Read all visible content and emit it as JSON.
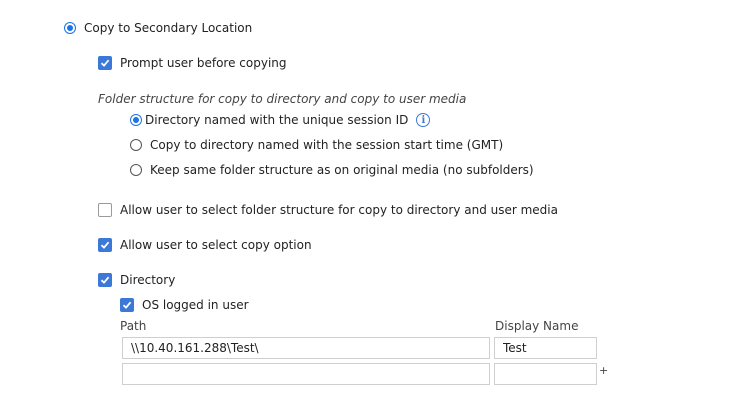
{
  "copy_secondary": {
    "label": "Copy to Secondary Location",
    "selected": true
  },
  "prompt_user": {
    "label": "Prompt user before copying",
    "checked": true
  },
  "folder_structure": {
    "heading": "Folder structure for copy to directory and copy to user media",
    "options": [
      {
        "label": "Directory named with the unique session ID",
        "selected": true
      },
      {
        "label": "Copy to directory named with the session start time (GMT)",
        "selected": false
      },
      {
        "label": "Keep same folder structure as on original media (no subfolders)",
        "selected": false
      }
    ]
  },
  "allow_folder_structure": {
    "label": "Allow user to select folder structure for copy to directory and user media",
    "checked": false
  },
  "allow_copy_option": {
    "label": "Allow user to select copy option",
    "checked": true
  },
  "directory": {
    "label": "Directory",
    "checked": true
  },
  "os_logged_in": {
    "label": "OS logged in user",
    "checked": true
  },
  "table": {
    "path_header": "Path",
    "display_header": "Display Name",
    "rows": [
      {
        "path": "\\\\10.40.161.288\\Test\\",
        "display": "Test"
      },
      {
        "path": "",
        "display": ""
      }
    ],
    "add_symbol": "+"
  },
  "icons": {
    "info": "info-icon",
    "check": "checkmark-icon"
  },
  "colors": {
    "accent": "#3b78d8",
    "radio": "#1a73e8"
  }
}
